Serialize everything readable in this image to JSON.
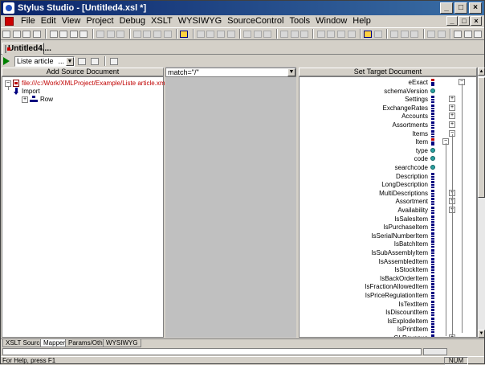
{
  "window": {
    "title": "Stylus Studio - [Untitled4.xsl *]",
    "minimize": "_",
    "maximize": "□",
    "close": "×"
  },
  "menu": [
    "File",
    "Edit",
    "View",
    "Project",
    "Debug",
    "XSLT",
    "WYSIWYG",
    "SourceControl",
    "Tools",
    "Window",
    "Help"
  ],
  "document_tab": "Untitled4....",
  "toolbar2": {
    "combo_value": "Liste article",
    "combo_suffix": "..."
  },
  "source_panel": {
    "header": "Add Source Document",
    "file": "file:///c:/Work/XMLProject/Example/Liste article.xml",
    "nodes": [
      "Import",
      "Row"
    ]
  },
  "mapper": {
    "match": "match=\"/\""
  },
  "target_panel": {
    "header": "Set Target Document",
    "nodes": [
      {
        "label": "eExact",
        "kind": "root",
        "pm": "-"
      },
      {
        "label": "schemaVersion",
        "kind": "attr"
      },
      {
        "label": "Settings",
        "kind": "el",
        "pm": "+"
      },
      {
        "label": "ExchangeRates",
        "kind": "el",
        "pm": "+"
      },
      {
        "label": "Accounts",
        "kind": "el",
        "pm": "+"
      },
      {
        "label": "Assortments",
        "kind": "el",
        "pm": "+"
      },
      {
        "label": "Items",
        "kind": "el",
        "pm": "-"
      },
      {
        "label": "Item",
        "kind": "item",
        "pm": "-"
      },
      {
        "label": "type",
        "kind": "attr"
      },
      {
        "label": "code",
        "kind": "attr"
      },
      {
        "label": "searchcode",
        "kind": "attr"
      },
      {
        "label": "Description",
        "kind": "el"
      },
      {
        "label": "LongDescription",
        "kind": "el"
      },
      {
        "label": "MultiDescriptions",
        "kind": "el",
        "pm": "+"
      },
      {
        "label": "Assortment",
        "kind": "el",
        "pm": "+"
      },
      {
        "label": "Availability",
        "kind": "el",
        "pm": "+"
      },
      {
        "label": "IsSalesItem",
        "kind": "el"
      },
      {
        "label": "IsPurchaseItem",
        "kind": "el"
      },
      {
        "label": "IsSerialNumberItem",
        "kind": "el"
      },
      {
        "label": "IsBatchItem",
        "kind": "el"
      },
      {
        "label": "IsSubAssemblyItem",
        "kind": "el"
      },
      {
        "label": "IsAssembledItem",
        "kind": "el"
      },
      {
        "label": "IsStockItem",
        "kind": "el"
      },
      {
        "label": "IsBackOrderItem",
        "kind": "el"
      },
      {
        "label": "IsFractionAllowedItem",
        "kind": "el"
      },
      {
        "label": "IsPriceRegulationItem",
        "kind": "el"
      },
      {
        "label": "IsTextItem",
        "kind": "el"
      },
      {
        "label": "IsDiscountItem",
        "kind": "el"
      },
      {
        "label": "IsExplodeItem",
        "kind": "el"
      },
      {
        "label": "IsPrintItem",
        "kind": "el"
      },
      {
        "label": "GLRevenue",
        "kind": "el",
        "pm": "+"
      }
    ]
  },
  "bottom_tabs": [
    "XSLT Source",
    "Mapper",
    "Params/Other",
    "WYSIWYG"
  ],
  "status": {
    "text": "For Help, press F1",
    "num": "NUM"
  }
}
